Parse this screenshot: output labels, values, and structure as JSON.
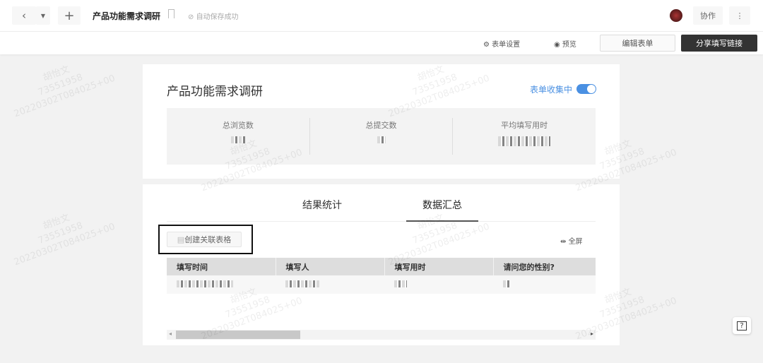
{
  "header": {
    "title": "产品功能需求调研",
    "autosave": "自动保存成功",
    "collab": "协作",
    "more": "⋮"
  },
  "subbar": {
    "settings": "表单设置",
    "preview": "预览",
    "edit": "编辑表单",
    "share": "分享填写链接"
  },
  "summary": {
    "title": "产品功能需求调研",
    "collecting_label": "表单收集中",
    "collecting": true,
    "stats": [
      {
        "label": "总浏览数"
      },
      {
        "label": "总提交数"
      },
      {
        "label": "平均填写用时"
      }
    ]
  },
  "results": {
    "tabs": [
      {
        "label": "结果统计",
        "active": false
      },
      {
        "label": "数据汇总",
        "active": true
      }
    ],
    "create_table": "创建关联表格",
    "fullscreen": "全屏",
    "columns": [
      "填写时间",
      "填写人",
      "填写用时",
      "请问您的性别?"
    ]
  },
  "watermark": {
    "name": "胡怡文",
    "id": "73551958",
    "time": "20220302T084025+00"
  },
  "colors": {
    "accent": "#4a90e2",
    "dark_button": "#333"
  }
}
